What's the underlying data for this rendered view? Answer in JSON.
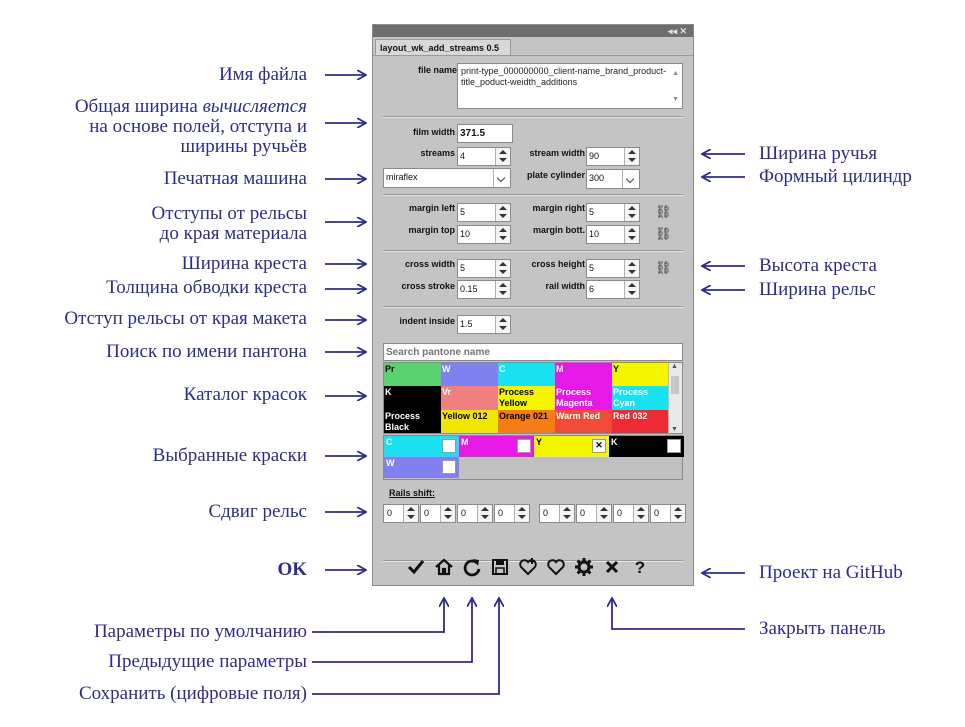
{
  "annotations_left": {
    "file_name": "Имя файла",
    "total_width_1": "Общая ширина ",
    "total_width_1_italic": "вычисляется",
    "total_width_2": "на основе полей, отступа и",
    "total_width_3": "ширины ручьёв",
    "press": "Печатная машина",
    "margins_1": "Отступы от рельсы",
    "margins_2": "до края материала",
    "cross_width": "Ширина креста",
    "cross_stroke": "Толщина обводки креста",
    "indent": "Отступ рельсы от края макета",
    "pantone_search": "Поиск по имени пантона",
    "catalog": "Каталог красок",
    "selected": "Выбранные краски",
    "rails_shift": "Сдвиг рельс",
    "ok": "OK",
    "defaults": "Параметры по умолчанию",
    "previous": "Предыдущие параметры",
    "save": "Сохранить (цифровые поля)"
  },
  "annotations_right": {
    "stream_width": "Ширина ручья",
    "plate_cylinder": "Формный цилиндр",
    "cross_height": "Высота креста",
    "rail_width": "Ширина рельс",
    "github": "Проект на GitHub",
    "close": "Закрыть панель"
  },
  "panel": {
    "title_controls": "◂◂  ✕",
    "tab": "layout_wk_add_streams 0.5",
    "file_name_label": "file name:",
    "file_name_value": "print-type_000000000_client-name_brand_product-title_poduct-weidth_additions",
    "film_width_label": "film width",
    "film_width_value": "371.5",
    "streams_label": "streams",
    "streams_value": "4",
    "stream_width_label": "stream width",
    "stream_width_value": "90",
    "press_value": "miraflex",
    "plate_cylinder_label": "plate cylinder",
    "plate_cylinder_value": "300",
    "margin_left_label": "margin left",
    "margin_left_value": "5",
    "margin_right_label": "margin right",
    "margin_right_value": "5",
    "margin_top_label": "margin top",
    "margin_top_value": "10",
    "margin_bott_label": "margin bott.",
    "margin_bott_value": "10",
    "cross_width_label": "cross width",
    "cross_width_value": "5",
    "cross_height_label": "cross height",
    "cross_height_value": "5",
    "cross_stroke_label": "cross stroke",
    "cross_stroke_value": "0.15",
    "rail_width_label": "rail width",
    "rail_width_value": "6",
    "indent_label": "indent inside",
    "indent_value": "1.5",
    "search_placeholder": "Search pantone name",
    "swatches": [
      {
        "name": "Pr",
        "color": "#5ad26e",
        "text": "#000"
      },
      {
        "name": "W",
        "color": "#8080f0",
        "text": "#fff"
      },
      {
        "name": "C",
        "color": "#19e1f0",
        "text": "#fff"
      },
      {
        "name": "M",
        "color": "#e619e6",
        "text": "#fff"
      },
      {
        "name": "Y",
        "color": "#f5f500",
        "text": "#000"
      },
      {
        "name": "K",
        "color": "#000000",
        "text": "#fff"
      },
      {
        "name": "Vr",
        "color": "#f08080",
        "text": "#fff"
      },
      {
        "name": "Process Yellow",
        "color": "#f5f500",
        "text": "#000"
      },
      {
        "name": "Process Magenta",
        "color": "#e619e6",
        "text": "#fff"
      },
      {
        "name": "Process Cyan",
        "color": "#19e1f0",
        "text": "#fff"
      },
      {
        "name": "Process Black",
        "color": "#000000",
        "text": "#fff"
      },
      {
        "name": "Yellow 012",
        "color": "#f0e600",
        "text": "#000"
      },
      {
        "name": "Orange 021",
        "color": "#f57d14",
        "text": "#000"
      },
      {
        "name": "Warm Red",
        "color": "#f04b37",
        "text": "#fff"
      },
      {
        "name": "Red 032",
        "color": "#ee2a35",
        "text": "#fff"
      }
    ],
    "selected_inks": [
      {
        "name": "C",
        "color": "#19e1f0",
        "text": "#fff"
      },
      {
        "name": "M",
        "color": "#e619e6",
        "text": "#fff"
      },
      {
        "name": "Y",
        "color": "#f5f500",
        "text": "#000"
      },
      {
        "name": "K",
        "color": "#000000",
        "text": "#fff"
      },
      {
        "name": "W",
        "color": "#8080f0",
        "text": "#fff"
      }
    ],
    "chip_close": "✕",
    "rails_shift_label": "Rails shift:",
    "rails_shift_values": [
      "0",
      "0",
      "0",
      "0",
      "0",
      "0",
      "0",
      "0"
    ],
    "buttons": {
      "ok": "check-icon",
      "defaults": "home-icon",
      "previous": "refresh-icon",
      "save": "save-icon",
      "github": "question-icon"
    }
  },
  "colors": {
    "annotation": "#2c2c8c",
    "panel_bg": "#c4c4c4"
  }
}
